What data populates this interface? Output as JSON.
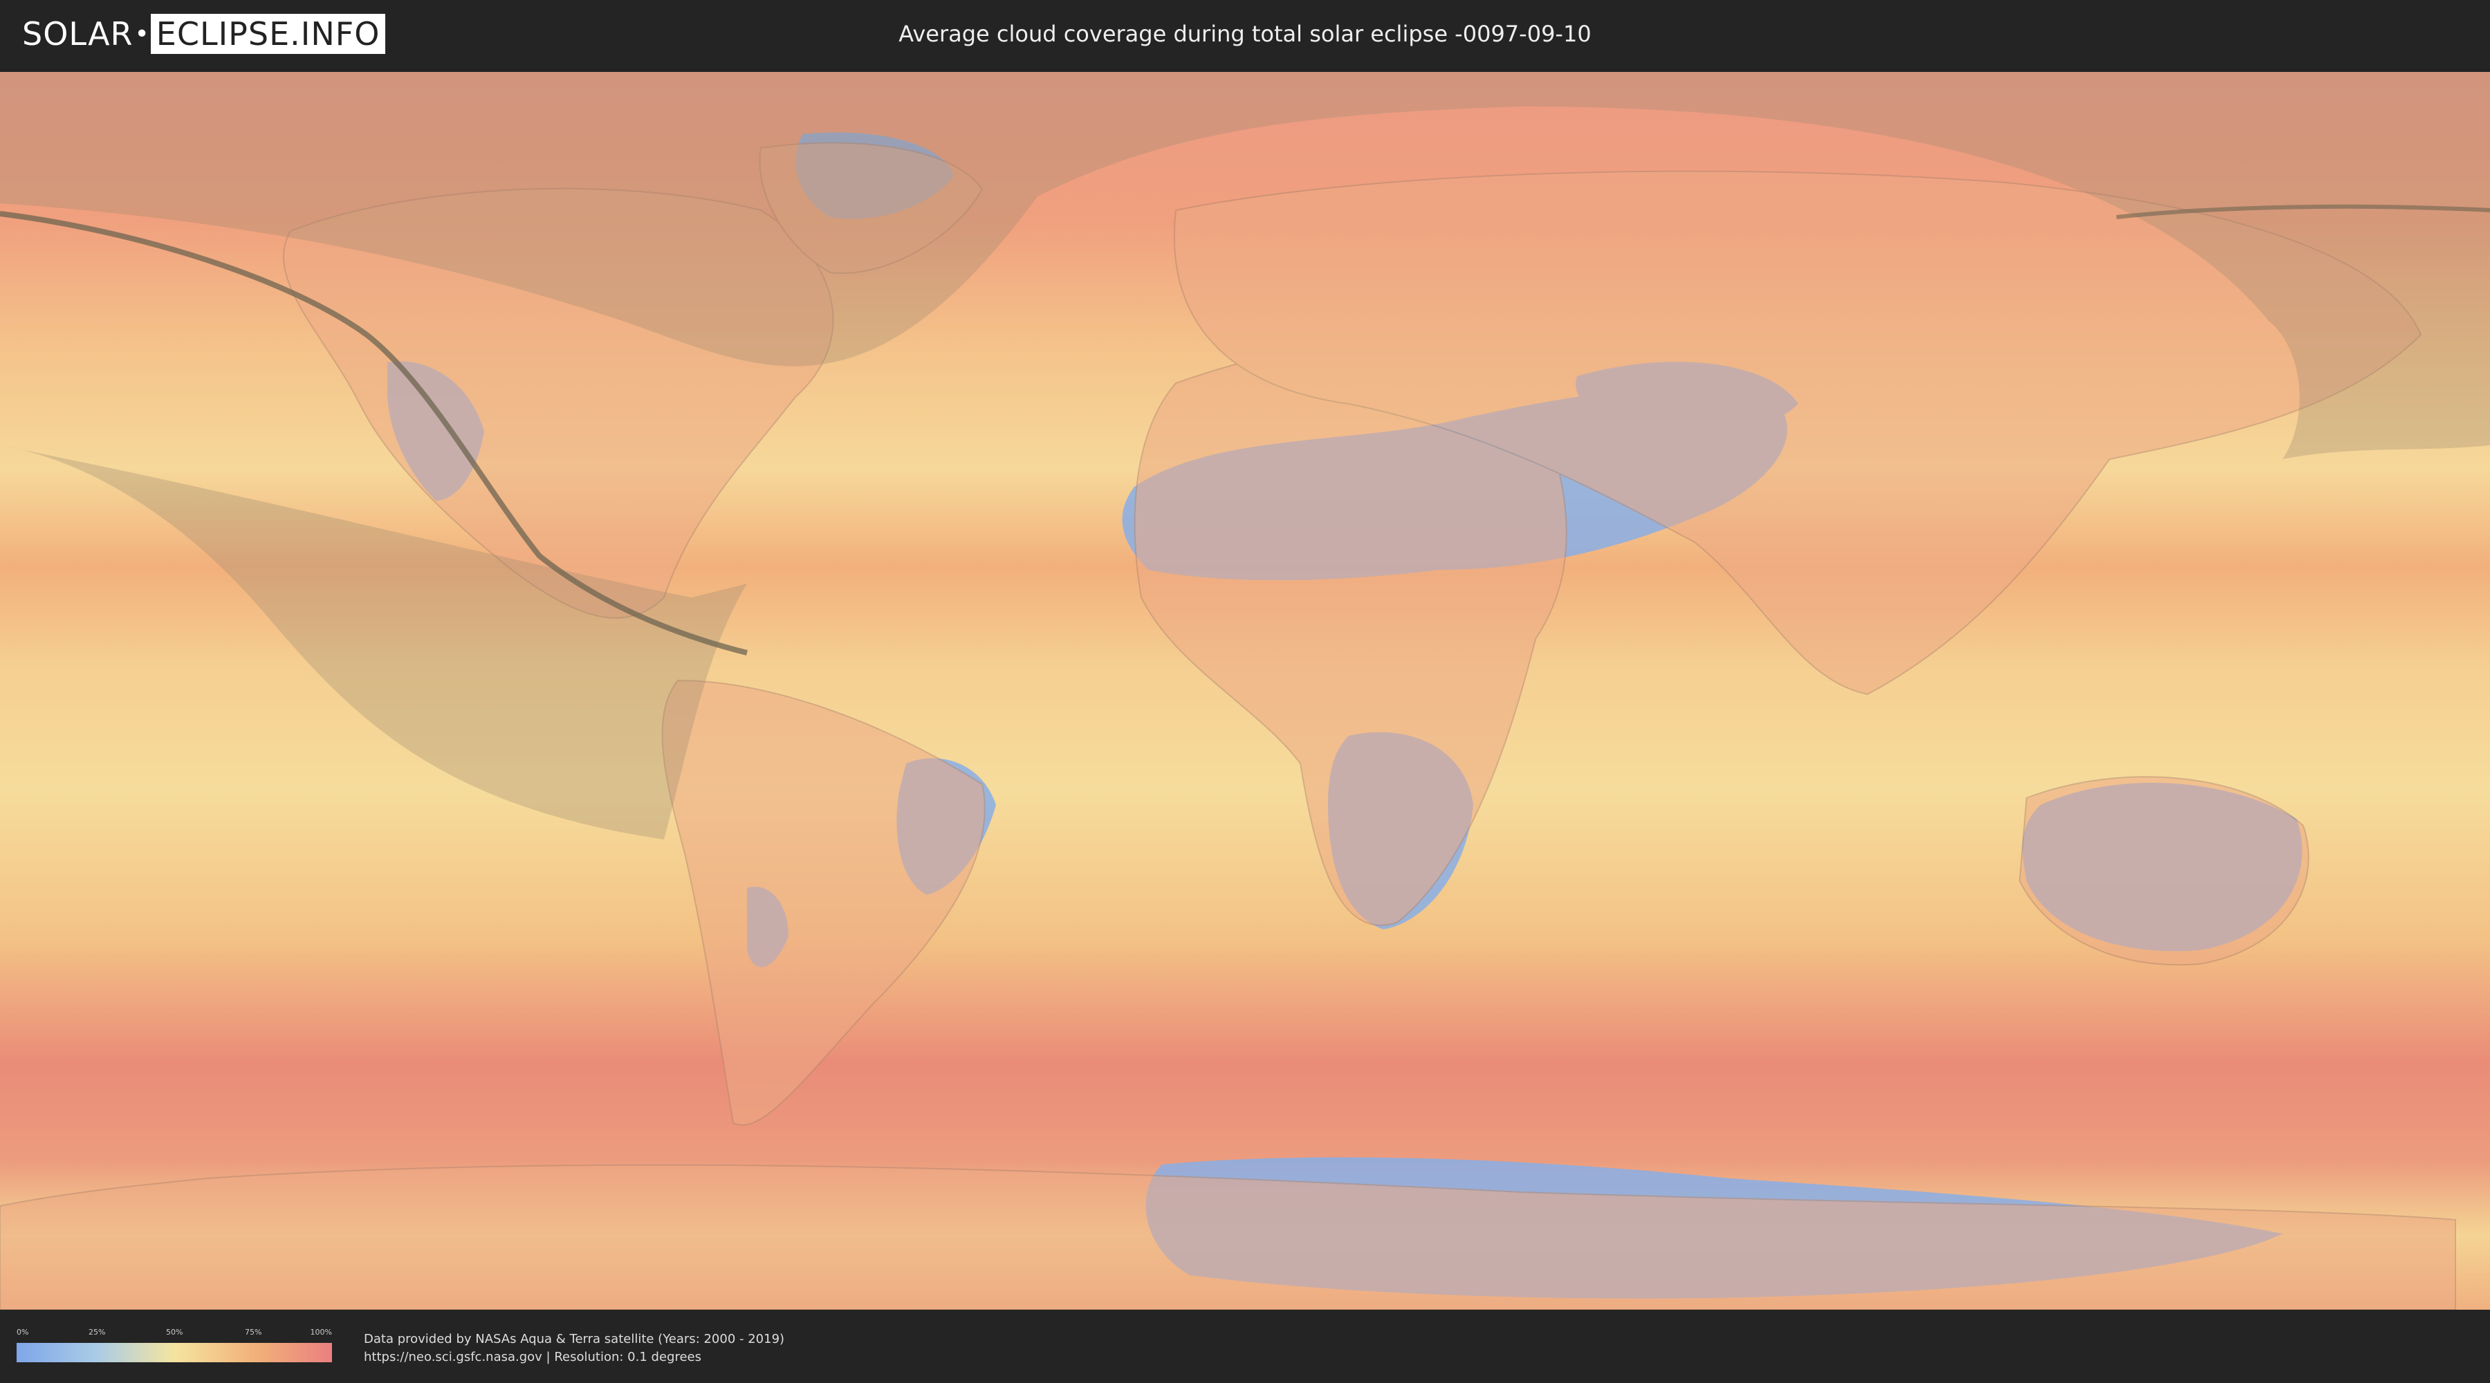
{
  "header": {
    "logo_left": "SOLAR",
    "logo_right": "ECLIPSE.INFO",
    "title": "Average cloud coverage during total solar eclipse -0097-09-10"
  },
  "legend": {
    "ticks": [
      "0%",
      "25%",
      "50%",
      "75%",
      "100%"
    ],
    "colors": [
      "#7fa6e8",
      "#a9cbe6",
      "#f5e4a0",
      "#f2b279",
      "#ea8080"
    ]
  },
  "credits": {
    "line1": "Data provided by NASAs Aqua & Terra satellite (Years: 2000 - 2019)",
    "line2": "https://neo.sci.gsfc.nasa.gov | Resolution: 0.1 degrees"
  }
}
